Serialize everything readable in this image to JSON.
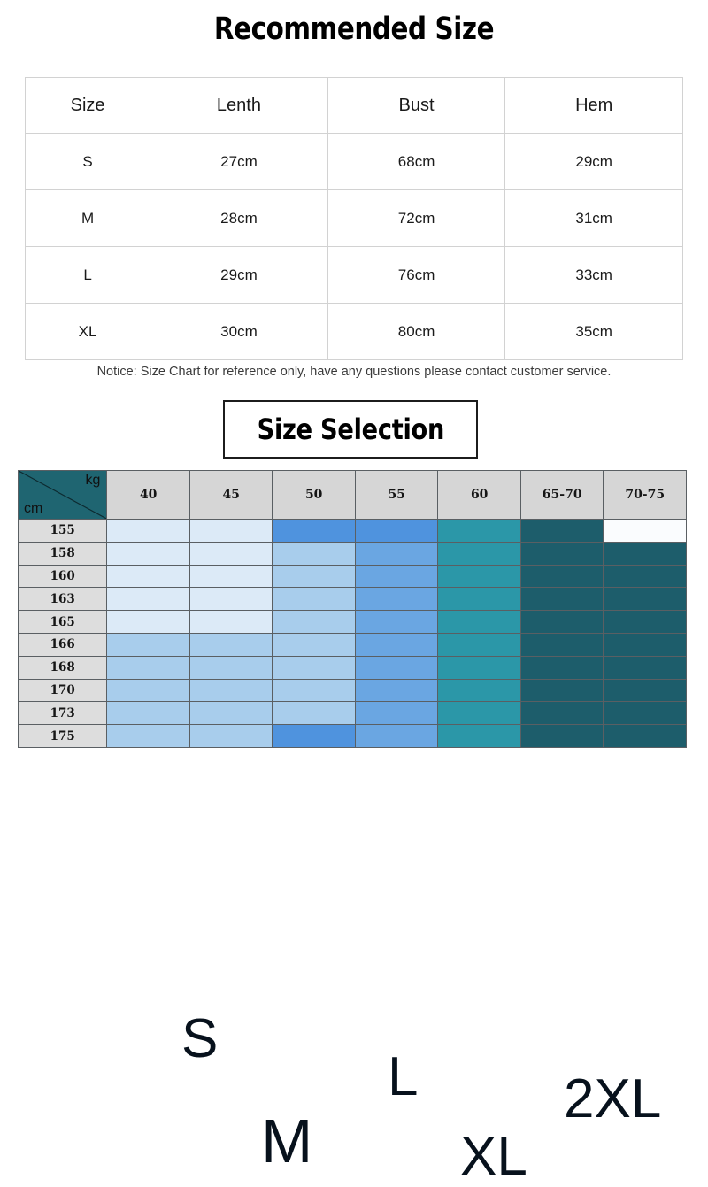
{
  "main_title": "Recommended Size",
  "rec_table": {
    "headers": [
      "Size",
      "Lenth",
      "Bust",
      "Hem"
    ],
    "rows": [
      [
        "S",
        "27cm",
        "68cm",
        "29cm"
      ],
      [
        "M",
        "28cm",
        "72cm",
        "31cm"
      ],
      [
        "L",
        "29cm",
        "76cm",
        "33cm"
      ],
      [
        "XL",
        "30cm",
        "80cm",
        "35cm"
      ]
    ]
  },
  "notice": "Notice: Size Chart for reference only, have any questions please contact customer service.",
  "selection_title": "Size Selection",
  "selection_grid": {
    "corner": {
      "kg": "kg",
      "cm": "cm"
    },
    "weight_headers": [
      "40",
      "45",
      "50",
      "55",
      "60",
      "65-70",
      "70-75"
    ],
    "height_rows": [
      "155",
      "158",
      "160",
      "163",
      "165",
      "166",
      "168",
      "170",
      "173",
      "175"
    ],
    "size_labels": [
      "S",
      "M",
      "L",
      "XL",
      "2XL"
    ],
    "colors": {
      "corner_teal": "#1f6571",
      "header_gray": "#d6d6d6",
      "row_head_gray": "#dddddd",
      "very_light_blue": "#dceaf7",
      "light_blue": "#a8cdec",
      "medium_blue": "#4f93de",
      "medium_blue_alt": "#6aa6e2",
      "teal": "#2b97a8",
      "dark_teal": "#1d5d6b",
      "blank": "#fafcfe",
      "grid_line": "#5a5f63"
    },
    "cell_colors": [
      [
        "b1",
        "b1",
        "b3",
        "b3",
        "t1",
        "t2",
        "blank"
      ],
      [
        "b1",
        "b1",
        "b2",
        "b4",
        "t1",
        "t2",
        "t2"
      ],
      [
        "b1",
        "b1",
        "b2",
        "b4",
        "t1",
        "t2",
        "t2"
      ],
      [
        "b1",
        "b1",
        "b2",
        "b4",
        "t1",
        "t2",
        "t2"
      ],
      [
        "b1",
        "b1",
        "b2",
        "b4",
        "t1",
        "t2",
        "t2"
      ],
      [
        "b2",
        "b2",
        "b2",
        "b4",
        "t1",
        "t2",
        "t2"
      ],
      [
        "b2",
        "b2",
        "b2",
        "b4",
        "t1",
        "t2",
        "t2"
      ],
      [
        "b2",
        "b2",
        "b2",
        "b4",
        "t1",
        "t2",
        "t2"
      ],
      [
        "b2",
        "b2",
        "b2",
        "b4",
        "t1",
        "t2",
        "t2"
      ],
      [
        "b2",
        "b2",
        "b3",
        "b4",
        "t1",
        "t2",
        "t2"
      ]
    ]
  },
  "chart_data": {
    "type": "table",
    "title": "Recommended Size",
    "columns": [
      "Size",
      "Lenth",
      "Bust",
      "Hem"
    ],
    "rows": [
      {
        "Size": "S",
        "Lenth": "27cm",
        "Bust": "68cm",
        "Hem": "29cm"
      },
      {
        "Size": "M",
        "Lenth": "28cm",
        "Bust": "72cm",
        "Hem": "31cm"
      },
      {
        "Size": "L",
        "Lenth": "29cm",
        "Bust": "76cm",
        "Hem": "33cm"
      },
      {
        "Size": "XL",
        "Lenth": "30cm",
        "Bust": "80cm",
        "Hem": "35cm"
      }
    ],
    "secondary": {
      "type": "heatmap",
      "title": "Size Selection",
      "xlabel": "kg",
      "ylabel": "cm",
      "x": [
        "40",
        "45",
        "50",
        "55",
        "60",
        "65-70",
        "70-75"
      ],
      "y": [
        "155",
        "158",
        "160",
        "163",
        "165",
        "166",
        "168",
        "170",
        "173",
        "175"
      ],
      "legend": [
        "S",
        "M",
        "L",
        "XL",
        "2XL"
      ]
    }
  }
}
